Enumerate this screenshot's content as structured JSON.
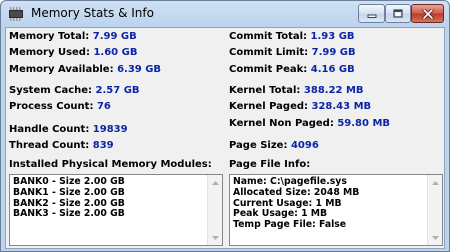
{
  "window": {
    "title": "Memory Stats & Info"
  },
  "left_stats": [
    {
      "label": "Memory Total:",
      "value": "7.99 GB"
    },
    {
      "label": "Memory Used:",
      "value": "1.60 GB"
    },
    {
      "label": "Memory Available:",
      "value": "6.39 GB"
    },
    {
      "label": "System Cache:",
      "value": "2.57 GB"
    },
    {
      "label": "Process Count:",
      "value": "76"
    },
    {
      "label": "Handle Count:",
      "value": "19839"
    },
    {
      "label": "Thread Count:",
      "value": "839"
    }
  ],
  "right_stats": [
    {
      "label": "Commit Total:",
      "value": "1.93 GB"
    },
    {
      "label": "Commit Limit:",
      "value": "7.99 GB"
    },
    {
      "label": "Commit Peak:",
      "value": "4.16 GB"
    },
    {
      "label": "Kernel Total:",
      "value": "388.22 MB"
    },
    {
      "label": "Kernel Paged:",
      "value": "328.43 MB"
    },
    {
      "label": "Kernel Non Paged:",
      "value": "59.80 MB"
    },
    {
      "label": "Page Size:",
      "value": "4096"
    }
  ],
  "modules": {
    "label": "Installed Physical Memory Modules:",
    "lines": [
      "BANK0 - Size 2.00 GB",
      "BANK1 - Size 2.00 GB",
      "BANK2 - Size 2.00 GB",
      "BANK3 - Size 2.00 GB"
    ]
  },
  "pagefile": {
    "label": "Page File Info:",
    "lines": [
      "Name: C:\\pagefile.sys",
      "Allocated Size: 2048 MB",
      "Current Usage: 1 MB",
      "Peak Usage: 1 MB",
      "Temp Page File: False"
    ]
  },
  "colors": {
    "value_text": "#0b24a8",
    "label_text": "#000000",
    "client_bg": "#f0f0f0"
  },
  "icons": {
    "app": "memory-chip-icon",
    "minimize": "minimize-icon",
    "maximize": "maximize-icon",
    "close": "close-icon",
    "scroll_up": "arrow-up-icon",
    "scroll_down": "arrow-down-icon"
  }
}
